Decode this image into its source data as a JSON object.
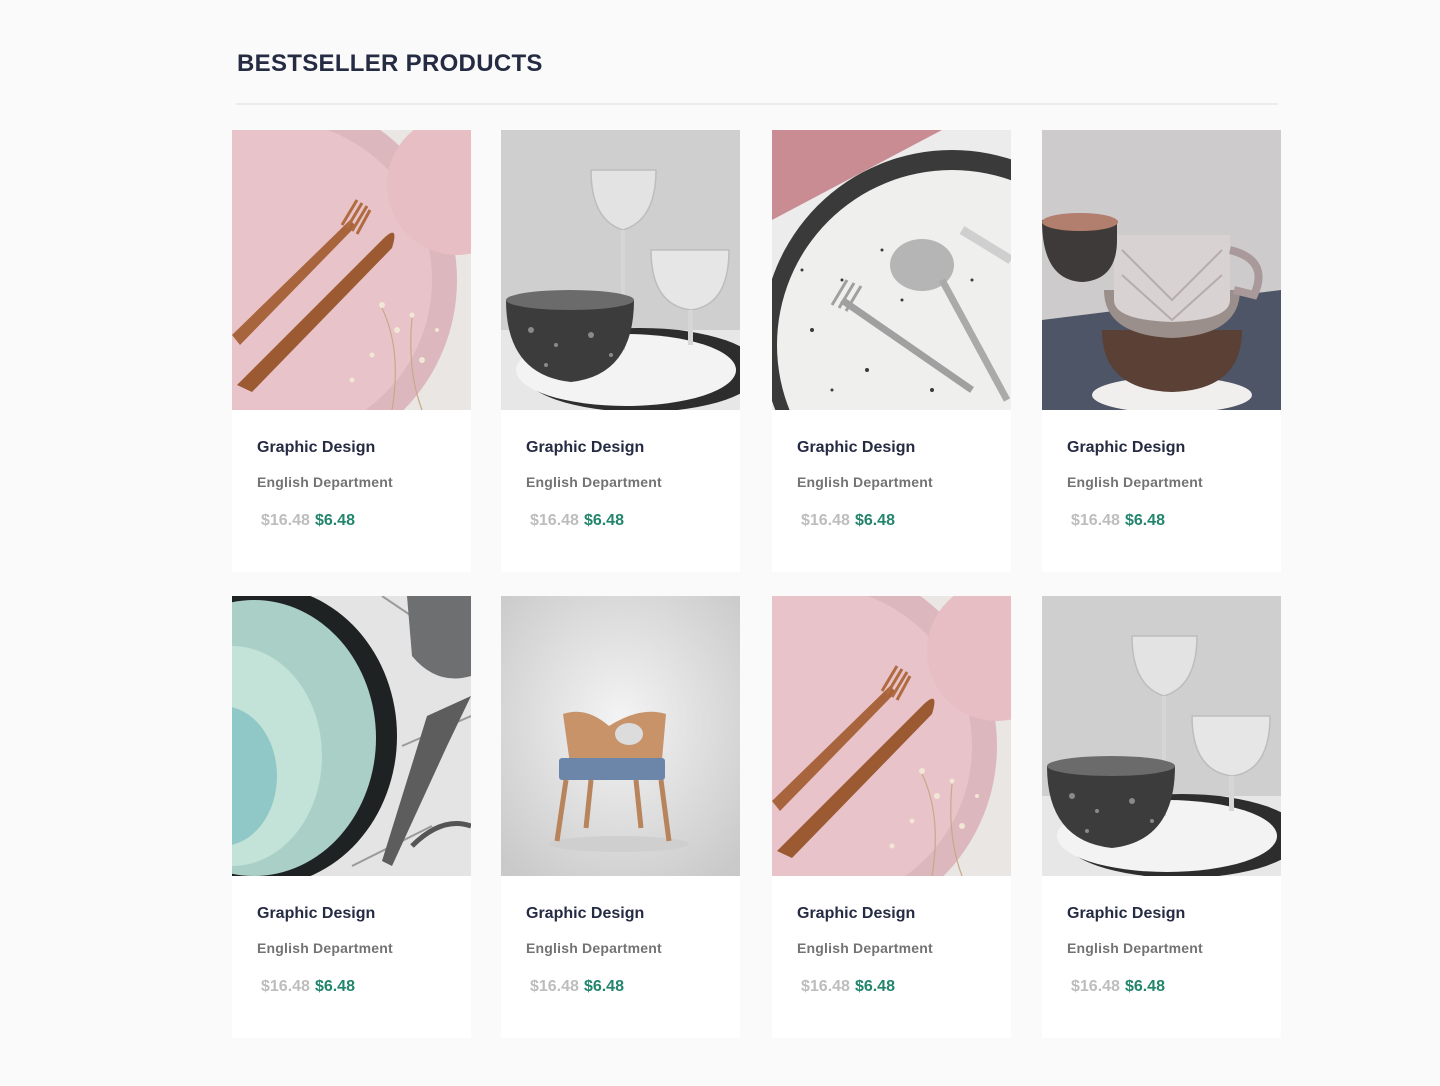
{
  "section": {
    "heading": "BESTSELLER PRODUCTS"
  },
  "colors": {
    "heading": "#252b42",
    "department": "#737373",
    "old_price": "#bdbdbd",
    "new_price": "#23856d",
    "card": "#ffffff",
    "background": "#fafafa"
  },
  "products": [
    {
      "title": "Graphic Design",
      "department": "English Department",
      "old_price": "$16.48",
      "new_price": "$6.48",
      "image": "pink-plate-copper-cutlery"
    },
    {
      "title": "Graphic Design",
      "department": "English Department",
      "old_price": "$16.48",
      "new_price": "$6.48",
      "image": "stone-bowl-wine-glasses"
    },
    {
      "title": "Graphic Design",
      "department": "English Department",
      "old_price": "$16.48",
      "new_price": "$6.48",
      "image": "speckled-plate-silver-cutlery"
    },
    {
      "title": "Graphic Design",
      "department": "English Department",
      "old_price": "$16.48",
      "new_price": "$6.48",
      "image": "stacked-cups-bowls"
    },
    {
      "title": "Graphic Design",
      "department": "English Department",
      "old_price": "$16.48",
      "new_price": "$6.48",
      "image": "celadon-bowl-marble"
    },
    {
      "title": "Graphic Design",
      "department": "English Department",
      "old_price": "$16.48",
      "new_price": "$6.48",
      "image": "wooden-chair"
    },
    {
      "title": "Graphic Design",
      "department": "English Department",
      "old_price": "$16.48",
      "new_price": "$6.48",
      "image": "pink-plate-copper-cutlery"
    },
    {
      "title": "Graphic Design",
      "department": "English Department",
      "old_price": "$16.48",
      "new_price": "$6.48",
      "image": "stone-bowl-wine-glasses"
    }
  ]
}
